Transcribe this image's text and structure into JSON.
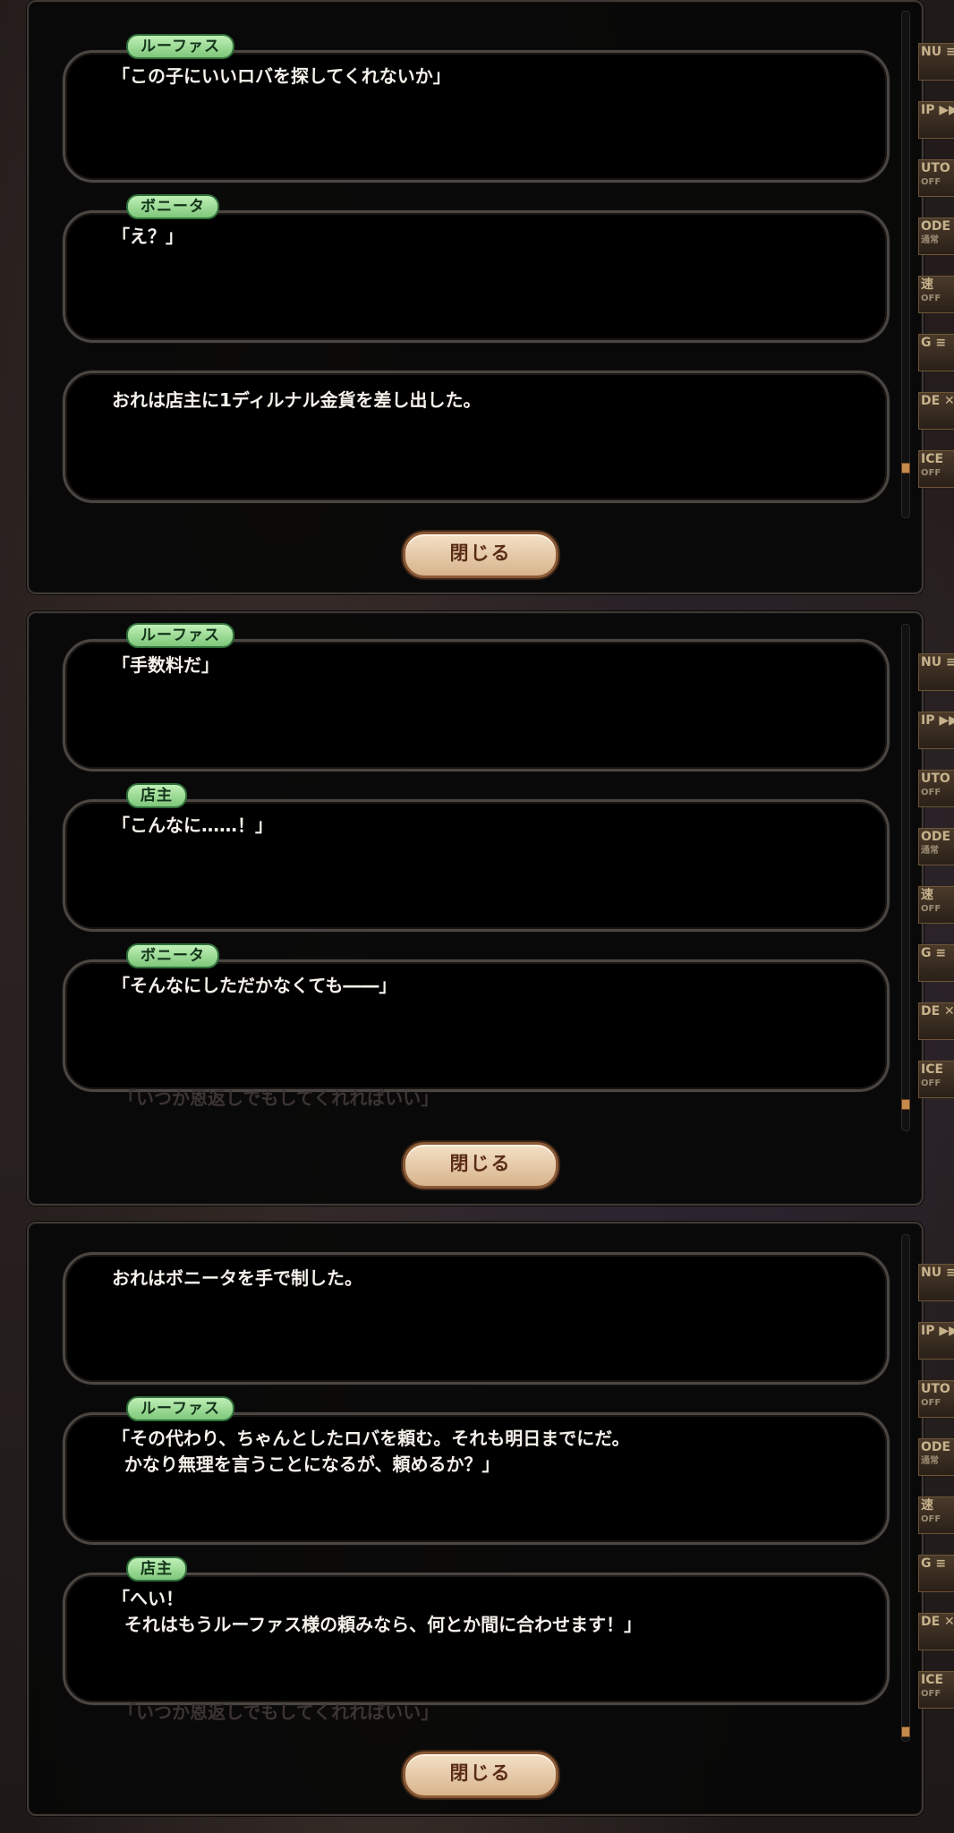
{
  "panels": [
    {
      "dialogs": [
        {
          "speaker": "ルーファス",
          "text": "「この子にいいロバを探してくれないか」"
        },
        {
          "speaker": "ボニータ",
          "text": "「え？」"
        },
        {
          "speaker": "",
          "text": "おれは店主に1ディルナル金貨を差し出した。"
        }
      ],
      "close_label": "閉じる"
    },
    {
      "dialogs": [
        {
          "speaker": "ルーファス",
          "text": "「手数料だ」"
        },
        {
          "speaker": "店主",
          "text": "「こんなに……！」"
        },
        {
          "speaker": "ボニータ",
          "text": "「そんなにしただかなくても――」"
        }
      ],
      "ghost_text": "「いつか恩返しでもしてくれればいい」",
      "close_label": "閉じる"
    },
    {
      "dialogs": [
        {
          "speaker": "",
          "text": "おれはボニータを手で制した。"
        },
        {
          "speaker": "ルーファス",
          "text": "「その代わり、ちゃんとしたロバを頼む。それも明日までにだ。\n  かなり無理を言うことになるが、頼めるか？」"
        },
        {
          "speaker": "店主",
          "text": "「へい！\n  それはもうルーファス様の頼みなら、何とか間に合わせます！」"
        }
      ],
      "ghost_text": "「いつか恩返しでもしてくれればいい」",
      "close_label": "閉じる"
    }
  ],
  "side_menu": [
    "NU ≡",
    "IP ▶▶",
    "UTO",
    "ODE",
    "速",
    "G ≡",
    "DE ✕",
    "ICE"
  ],
  "side_menu_sub": [
    "",
    "",
    "OFF",
    "通常",
    "OFF",
    "",
    "",
    "OFF"
  ],
  "colors": {
    "accent": "#c48a4b",
    "name_tag": "#7ec77a",
    "button": "#d8b48c"
  }
}
